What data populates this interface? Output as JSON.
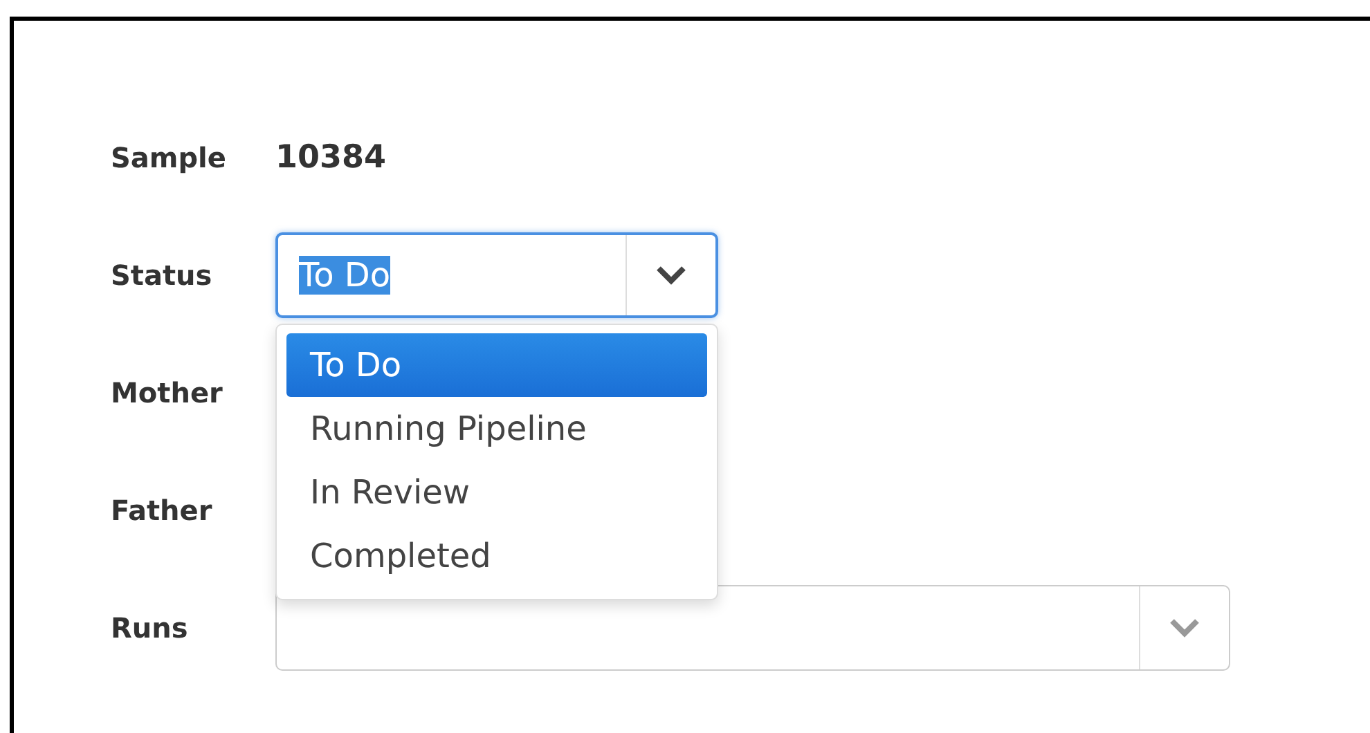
{
  "form": {
    "sample": {
      "label": "Sample",
      "value": "10384"
    },
    "status": {
      "label": "Status",
      "value": "To Do",
      "expanded": true,
      "options": [
        {
          "label": "To Do",
          "selected": true
        },
        {
          "label": "Running Pipeline",
          "selected": false
        },
        {
          "label": "In Review",
          "selected": false
        },
        {
          "label": "Completed",
          "selected": false
        }
      ]
    },
    "mother": {
      "label": "Mother"
    },
    "father": {
      "label": "Father"
    },
    "runs": {
      "label": "Runs"
    }
  }
}
